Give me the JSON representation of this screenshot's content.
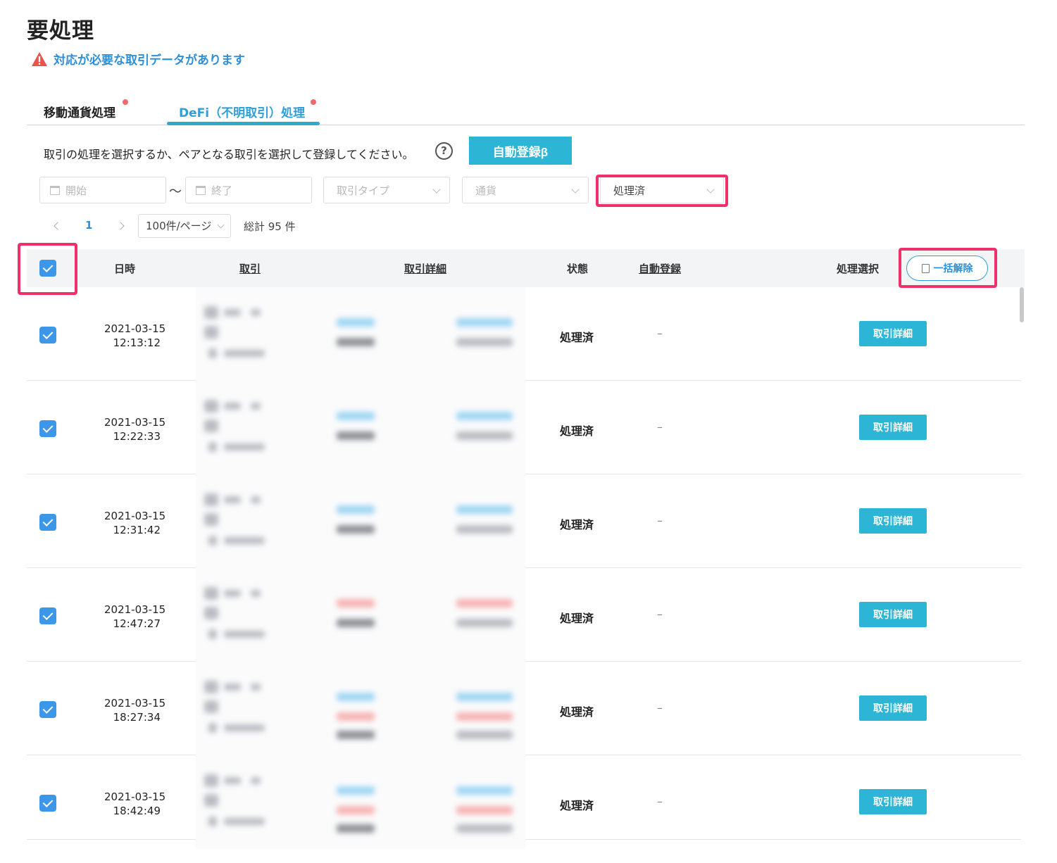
{
  "page": {
    "title": "要処理",
    "warning": "対応が必要な取引データがあります"
  },
  "tabs": [
    {
      "label": "移動通貨処理"
    },
    {
      "label": "DeFi（不明取引）処理"
    }
  ],
  "instruction": "取引の処理を選択するか、ペアとなる取引を選択して登録してください。",
  "help_symbol": "?",
  "auto_register_label": "自動登録β",
  "filters": {
    "start_placeholder": "開始",
    "end_placeholder": "終了",
    "range_separator": "〜",
    "type_placeholder": "取引タイプ",
    "currency_placeholder": "通貨",
    "status_value": "処理済"
  },
  "pagination": {
    "current_page": "1",
    "page_size": "100件/ページ",
    "total": "総計 95 件"
  },
  "table": {
    "headers": {
      "datetime": "日時",
      "transaction": "取引",
      "detail": "取引詳細",
      "status": "状態",
      "auto_register": "自動登録",
      "action": "処理選択",
      "bulk_release": "一括解除"
    },
    "rows": [
      {
        "date": "2021-03-15",
        "time": "12:13:12",
        "status": "処理済",
        "auto": "–",
        "button": "取引詳細",
        "detail_color": "blue"
      },
      {
        "date": "2021-03-15",
        "time": "12:22:33",
        "status": "処理済",
        "auto": "–",
        "button": "取引詳細",
        "detail_color": "blue"
      },
      {
        "date": "2021-03-15",
        "time": "12:31:42",
        "status": "処理済",
        "auto": "–",
        "button": "取引詳細",
        "detail_color": "blue"
      },
      {
        "date": "2021-03-15",
        "time": "12:47:27",
        "status": "処理済",
        "auto": "–",
        "button": "取引詳細",
        "detail_color": "red"
      },
      {
        "date": "2021-03-15",
        "time": "18:27:34",
        "status": "処理済",
        "auto": "–",
        "button": "取引詳細",
        "detail_color": "mixed"
      },
      {
        "date": "2021-03-15",
        "time": "18:42:49",
        "status": "処理済",
        "auto": "–",
        "button": "取引詳細",
        "detail_color": "mixed"
      }
    ]
  },
  "colors": {
    "accent": "#2cb5d4",
    "link_blue": "#2f8fd6",
    "highlight": "#f0306a",
    "warning_red": "#e8554f",
    "checkbox": "#3c97e8"
  }
}
